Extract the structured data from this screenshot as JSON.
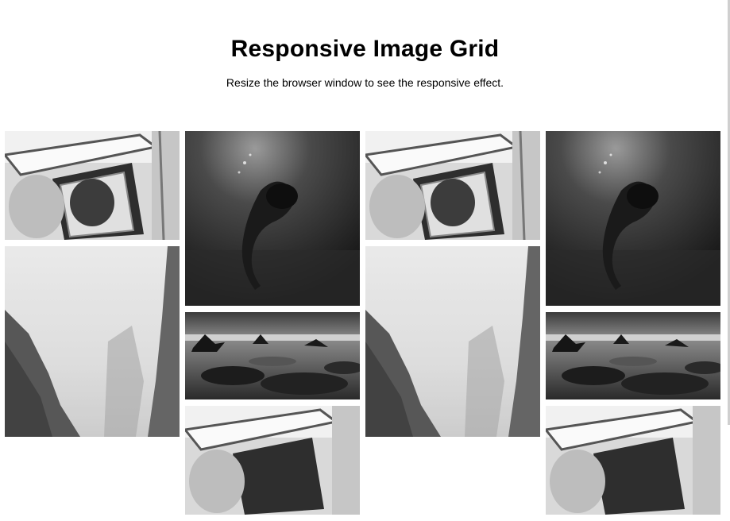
{
  "header": {
    "title": "Responsive Image Grid",
    "subtitle": "Resize the browser window to see the responsive effect."
  },
  "grid": {
    "columns": [
      {
        "tiles": [
          "car-photo",
          "fog-cliffs-photo"
        ]
      },
      {
        "tiles": [
          "underwater-diver-photo",
          "rocky-seashore-photo",
          "car-photo"
        ]
      },
      {
        "tiles": [
          "car-photo",
          "fog-cliffs-photo"
        ]
      },
      {
        "tiles": [
          "underwater-diver-photo",
          "rocky-seashore-photo",
          "car-photo"
        ]
      }
    ]
  },
  "colors": {
    "background": "#ffffff",
    "text": "#000000"
  }
}
